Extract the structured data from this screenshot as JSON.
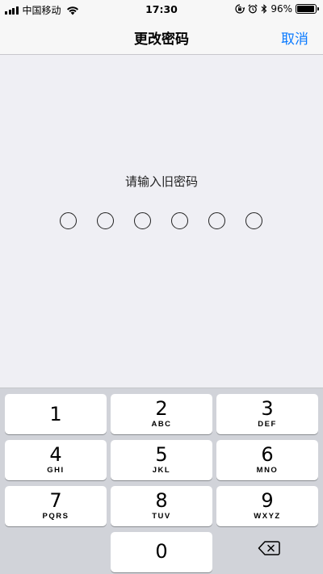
{
  "status_bar": {
    "carrier": "中国移动",
    "time": "17:30",
    "battery": "96%",
    "battery_level": 0.96
  },
  "nav": {
    "title": "更改密码",
    "cancel": "取消"
  },
  "prompt": "请输入旧密码",
  "passcode_length": 6,
  "keypad": {
    "keys": [
      {
        "num": "1",
        "letters": ""
      },
      {
        "num": "2",
        "letters": "ABC"
      },
      {
        "num": "3",
        "letters": "DEF"
      },
      {
        "num": "4",
        "letters": "GHI"
      },
      {
        "num": "5",
        "letters": "JKL"
      },
      {
        "num": "6",
        "letters": "MNO"
      },
      {
        "num": "7",
        "letters": "PQRS"
      },
      {
        "num": "8",
        "letters": "TUV"
      },
      {
        "num": "9",
        "letters": "WXYZ"
      },
      {
        "num": "0",
        "letters": ""
      }
    ],
    "delete_icon": "backspace-icon"
  },
  "colors": {
    "accent": "#0a7aff",
    "background": "#efeff4",
    "keypad_bg": "#d1d3d9"
  }
}
